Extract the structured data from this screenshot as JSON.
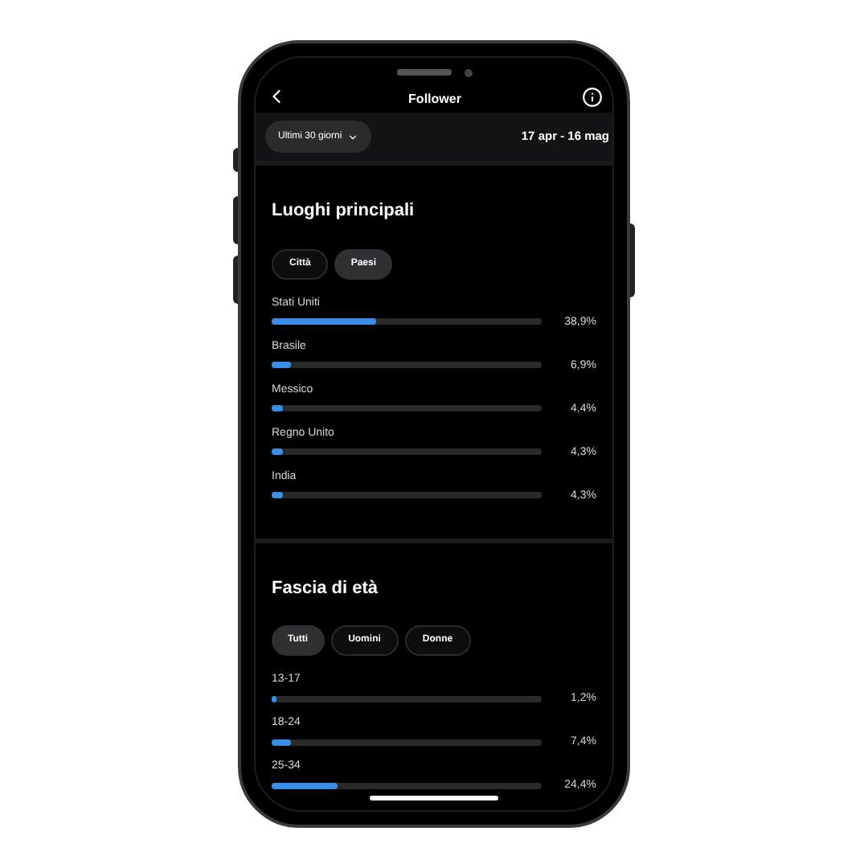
{
  "header": {
    "title": "Follower"
  },
  "period": {
    "label": "Ultimi 30 giorni",
    "range": "17 apr - 16 mag"
  },
  "sections": [
    {
      "title": "Luoghi principali",
      "filters": [
        {
          "label": "Città",
          "selected": false
        },
        {
          "label": "Paesi",
          "selected": true
        }
      ],
      "rows": [
        {
          "name": "Stati Uniti",
          "level": 0.389,
          "reading": "38,9%"
        },
        {
          "name": "Brasile",
          "level": 0.069,
          "reading": "6,9%"
        },
        {
          "name": "Messico",
          "level": 0.044,
          "reading": "4,4%"
        },
        {
          "name": "Regno Unito",
          "level": 0.043,
          "reading": "4,3%"
        },
        {
          "name": "India",
          "level": 0.043,
          "reading": "4,3%"
        }
      ]
    },
    {
      "title": "Fascia di età",
      "filters": [
        {
          "label": "Tutti",
          "selected": true
        },
        {
          "label": "Uomini",
          "selected": false
        },
        {
          "label": "Donne",
          "selected": false
        }
      ],
      "rows": [
        {
          "name": "13-17",
          "level": 0.012,
          "reading": "1,2%"
        },
        {
          "name": "18-24",
          "level": 0.074,
          "reading": "7,4%"
        },
        {
          "name": "25-34",
          "level": 0.244,
          "reading": "24,4%"
        }
      ]
    }
  ]
}
